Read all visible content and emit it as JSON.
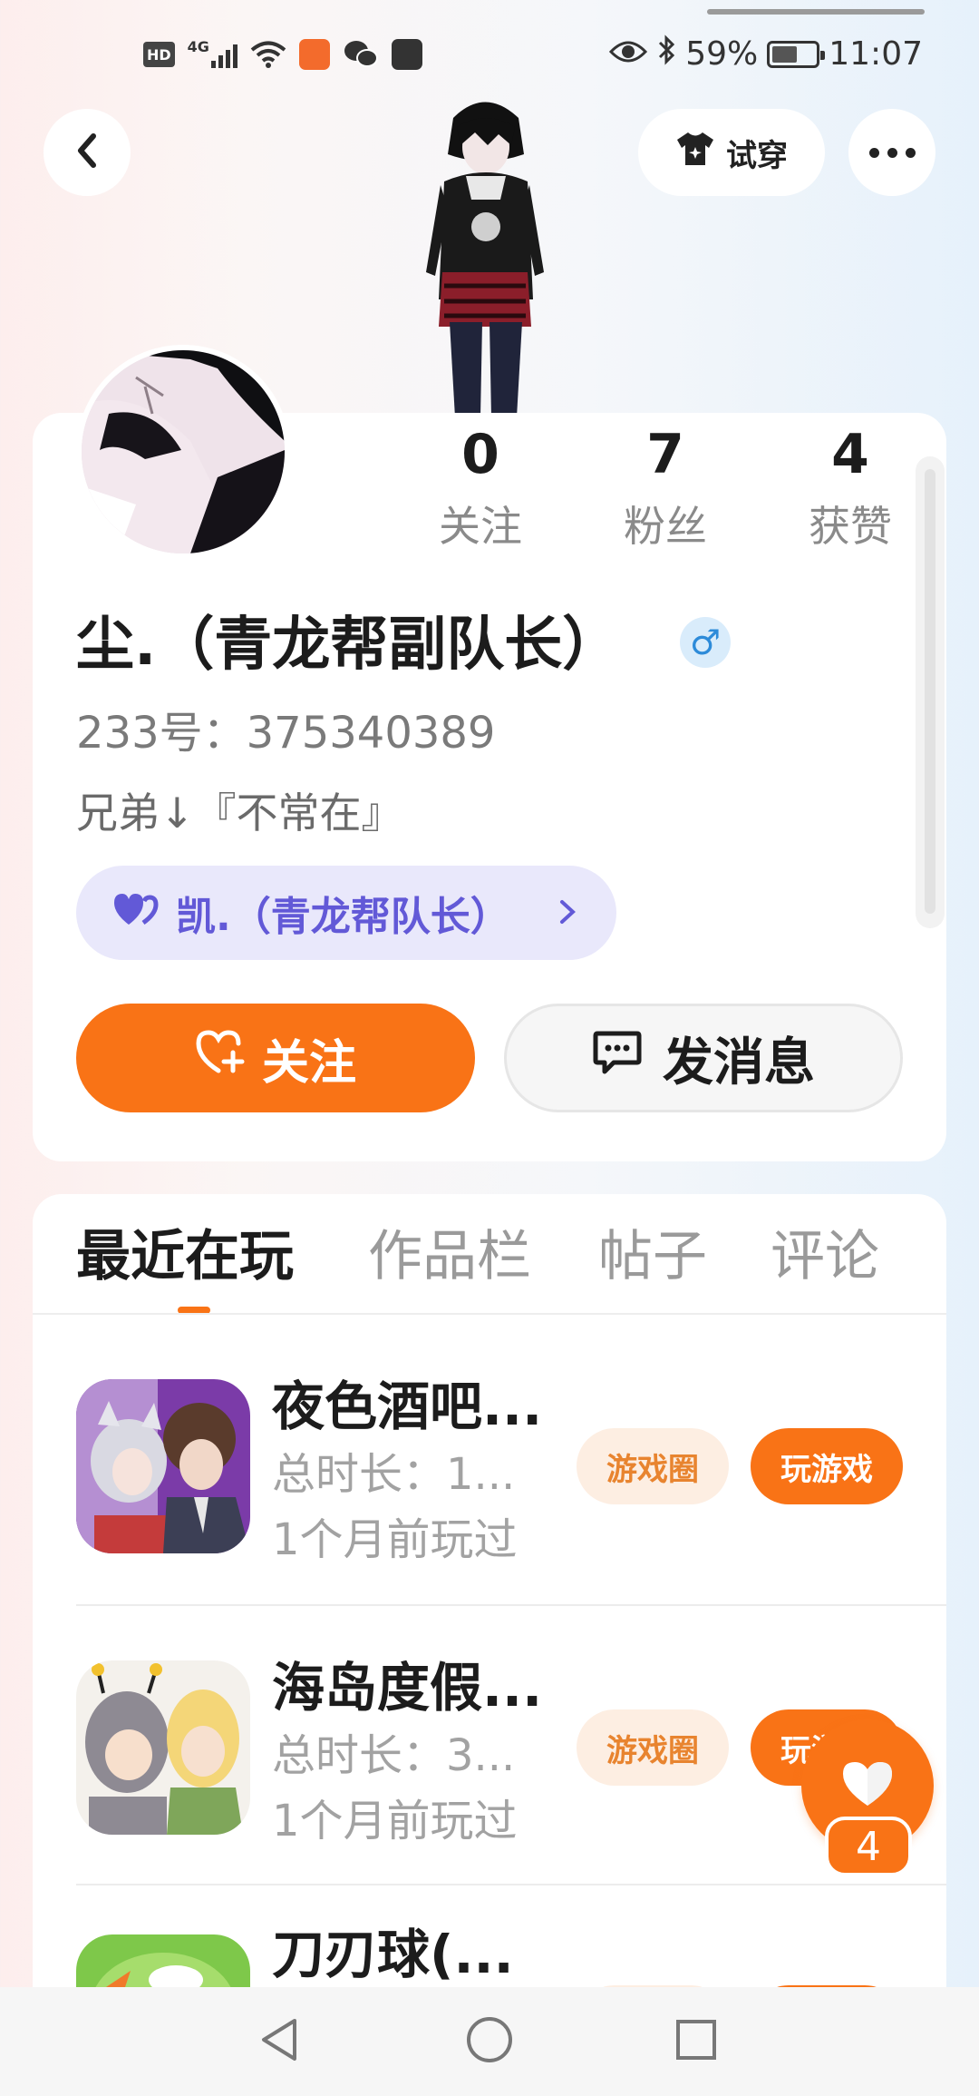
{
  "status_bar": {
    "battery_percent": "59%",
    "time": "11:07",
    "network_label": "4G",
    "hd_label": "HD",
    "battery_level": 0.59
  },
  "header": {
    "tryon_label": "试穿"
  },
  "profile": {
    "stats": [
      {
        "value": "0",
        "label": "关注"
      },
      {
        "value": "7",
        "label": "粉丝"
      },
      {
        "value": "4",
        "label": "获赞"
      }
    ],
    "username": "尘.（青龙帮副队长）",
    "gender_symbol": "♂",
    "user_id": "233号：375340389",
    "bio": "兄弟↓『不常在』",
    "relation_label": "凯.（青龙帮队长）",
    "follow_label": "关注",
    "message_label": "发消息"
  },
  "tabs": [
    "最近在玩",
    "作品栏",
    "帖子",
    "评论"
  ],
  "games": [
    {
      "title": "夜色酒吧...",
      "duration": "总时长：1...",
      "last_played": "1个月前玩过",
      "circle_label": "游戏圈",
      "play_label": "玩游戏"
    },
    {
      "title": "海岛度假...",
      "duration": "总时长：3...",
      "last_played": "1个月前玩过",
      "circle_label": "游戏圈",
      "play_label": "玩游戏"
    },
    {
      "title": "刀刃球(...",
      "duration": "",
      "last_played": "",
      "circle_label": "",
      "play_label": ""
    }
  ],
  "like": {
    "count": "4"
  },
  "colors": {
    "accent": "#f97316",
    "accent_soft": "#fdeee2",
    "relation_bg": "#e9e8fb",
    "relation_text": "#6259d7",
    "gender_blue": "#2d8bd9"
  },
  "icons": {
    "back": "chevron-left-icon",
    "tryon": "tshirt-icon",
    "more": "more-dots-icon",
    "follow": "heart-plus-icon",
    "message": "chat-bubble-icon",
    "relation": "double-heart-icon",
    "like": "heart-icon"
  }
}
